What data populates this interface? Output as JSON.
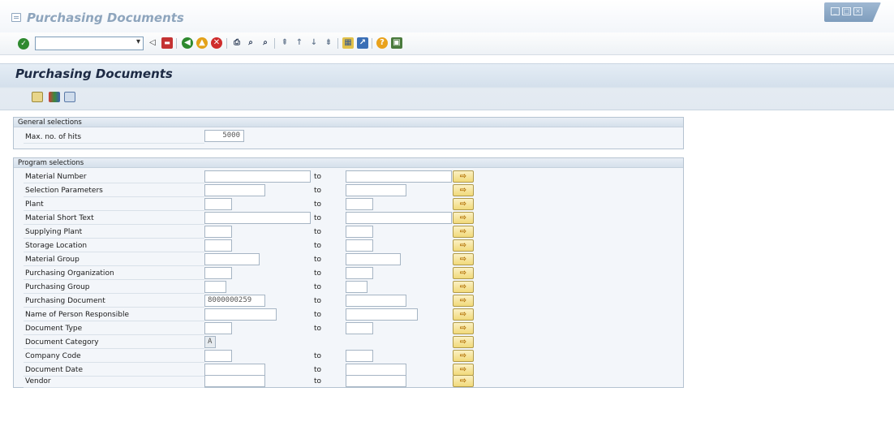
{
  "window": {
    "title": "Purchasing Documents"
  },
  "toolbar": {
    "command_field_value": "",
    "icons": [
      "enter-icon",
      "back-icon",
      "save-icon",
      "back-nav-icon",
      "exit-icon",
      "cancel-icon",
      "print-icon",
      "find-icon",
      "find-next-icon",
      "first-page-icon",
      "previous-page-icon",
      "next-page-icon",
      "last-page-icon",
      "create-session-icon",
      "shortcut-icon",
      "help-icon",
      "customize-layout-icon"
    ]
  },
  "page": {
    "title": "Purchasing Documents",
    "app_toolbar_icons": [
      "execute-icon",
      "get-variant-icon",
      "selection-options-icon"
    ]
  },
  "general_selections": {
    "title": "General selections",
    "max_hits_label": "Max. no. of hits",
    "max_hits_value": "5000"
  },
  "program_selections": {
    "title": "Program selections",
    "to_label": "to",
    "rows": [
      {
        "label": "Material Number",
        "low": "",
        "high": ""
      },
      {
        "label": "Selection Parameters",
        "low": "",
        "high": ""
      },
      {
        "label": "Plant",
        "low": "",
        "high": ""
      },
      {
        "label": "Material Short Text",
        "low": "",
        "high": ""
      },
      {
        "label": "Supplying Plant",
        "low": "",
        "high": ""
      },
      {
        "label": "Storage Location",
        "low": "",
        "high": ""
      },
      {
        "label": "Material Group",
        "low": "",
        "high": ""
      },
      {
        "label": "Purchasing Organization",
        "low": "",
        "high": ""
      },
      {
        "label": "Purchasing Group",
        "low": "",
        "high": ""
      },
      {
        "label": "Purchasing Document",
        "low": "8000000259",
        "high": ""
      },
      {
        "label": "Name of Person Responsible",
        "low": "",
        "high": ""
      },
      {
        "label": "Document Type",
        "low": "",
        "high": ""
      },
      {
        "label": "Document Category",
        "low": "A",
        "high": ""
      },
      {
        "label": "Company Code",
        "low": "",
        "high": ""
      },
      {
        "label": "Document Date",
        "low": "",
        "high": ""
      },
      {
        "label": "Vendor",
        "low": "",
        "high": ""
      }
    ]
  },
  "colors": {
    "header_band": "#d4e0ec",
    "group_background": "#f3f6fa",
    "multi_select_button": "#f1d97a"
  }
}
